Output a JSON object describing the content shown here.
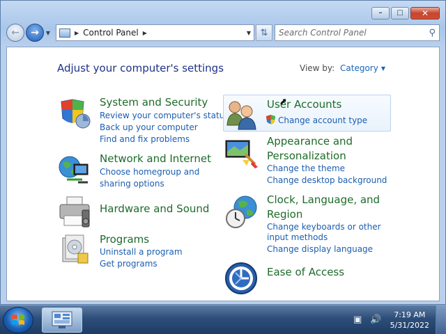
{
  "window": {
    "caption_buttons": {
      "minimize": "minimize-icon",
      "maximize": "maximize-icon",
      "close": "close-icon"
    }
  },
  "nav": {
    "address_crumbs": [
      "Control Panel"
    ],
    "search_placeholder": "Search Control Panel"
  },
  "header": {
    "title": "Adjust your computer's settings",
    "view_by_label": "View by:",
    "view_by_value": "Category"
  },
  "categories_left": [
    {
      "title": "System and Security",
      "links": [
        "Review your computer's status",
        "Back up your computer",
        "Find and fix problems"
      ]
    },
    {
      "title": "Network and Internet",
      "links": [
        "Choose homegroup and sharing options"
      ]
    },
    {
      "title": "Hardware and Sound",
      "links": []
    },
    {
      "title": "Programs",
      "links": [
        "Uninstall a program",
        "Get programs"
      ]
    }
  ],
  "categories_right": [
    {
      "title": "User Accounts",
      "links": [
        "Change account type"
      ]
    },
    {
      "title": "Appearance and Personalization",
      "links": [
        "Change the theme",
        "Change desktop background"
      ]
    },
    {
      "title": "Clock, Language, and Region",
      "links": [
        "Change keyboards or other input methods",
        "Change display language"
      ]
    },
    {
      "title": "Ease of Access",
      "links": []
    }
  ],
  "taskbar": {
    "clock_time": "7:19 AM",
    "clock_date": "5/31/2022"
  },
  "colors": {
    "heading": "#1e3287",
    "category_title": "#1e6b2b",
    "link": "#1a5eb0"
  }
}
